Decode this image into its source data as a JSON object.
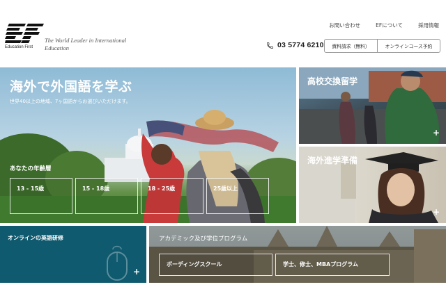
{
  "brand": {
    "logo_text": "EF",
    "logo_caption": "Education First",
    "tagline": "The World Leader in International Education"
  },
  "top_links": [
    "お問い合わせ",
    "EFについて",
    "採用情報"
  ],
  "phone": {
    "icon": "phone-icon",
    "number": "03 5774 6210"
  },
  "buttons": {
    "brochure": "資料請求（無料）",
    "online_booking": "オンラインコース予約"
  },
  "hero": {
    "title": "海外で外国語を学ぶ",
    "subtitle": "世界40以上の地域、7ヶ国語からお選びいただけます。",
    "age_label": "あなたの年齢層",
    "age_options": [
      "13 - 15歳",
      "15 - 18歳",
      "18 - 25歳",
      "25歳以上"
    ]
  },
  "tiles": {
    "exchange": {
      "title": "高校交換留学",
      "plus": "+"
    },
    "prep": {
      "title": "海外進学準備",
      "plus": "+"
    },
    "online": {
      "title": "オンラインの英語研修",
      "plus": "+",
      "icon": "mouse-icon"
    },
    "academic": {
      "title": "アカデミック及び学位プログラム",
      "buttons": [
        "ボーディングスクール",
        "学士、修士、MBAプログラム"
      ]
    }
  },
  "colors": {
    "online_tile": "#0f5a6e",
    "header_bg": "#ffffff"
  }
}
